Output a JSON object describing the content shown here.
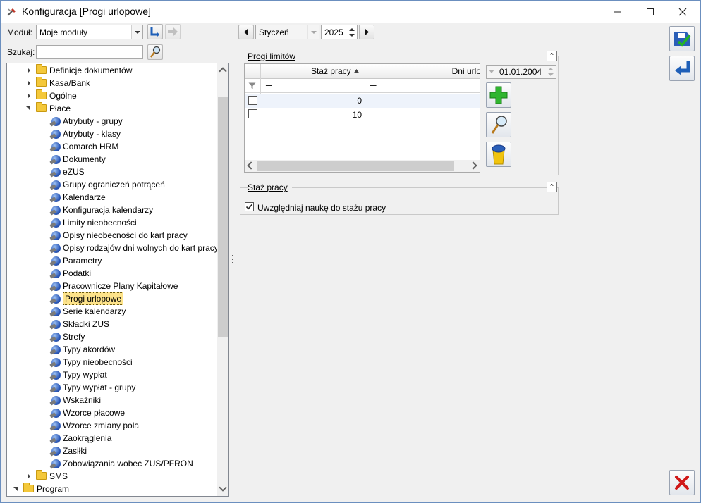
{
  "window": {
    "title": "Konfiguracja [Progi urlopowe]"
  },
  "toolbar": {
    "module_label": "Moduł:",
    "module_value": "Moje moduły",
    "search_label": "Szukaj:",
    "search_value": ""
  },
  "tree": {
    "top_items": [
      {
        "label": "Definicje dokumentów"
      },
      {
        "label": "Kasa/Bank"
      },
      {
        "label": "Ogólne"
      },
      {
        "label": "Płace"
      }
    ],
    "place_children": [
      {
        "label": "Atrybuty - grupy"
      },
      {
        "label": "Atrybuty - klasy"
      },
      {
        "label": "Comarch HRM"
      },
      {
        "label": "Dokumenty"
      },
      {
        "label": "eZUS"
      },
      {
        "label": "Grupy ograniczeń potrąceń"
      },
      {
        "label": "Kalendarze"
      },
      {
        "label": "Konfiguracja kalendarzy"
      },
      {
        "label": "Limity nieobecności"
      },
      {
        "label": "Opisy nieobecności do kart pracy"
      },
      {
        "label": "Opisy rodzajów dni wolnych do kart pracy"
      },
      {
        "label": "Parametry"
      },
      {
        "label": "Podatki"
      },
      {
        "label": "Pracownicze Plany Kapitałowe"
      },
      {
        "label": "Progi urlopowe"
      },
      {
        "label": "Serie kalendarzy"
      },
      {
        "label": "Składki ZUS"
      },
      {
        "label": "Strefy"
      },
      {
        "label": "Typy akordów"
      },
      {
        "label": "Typy nieobecności"
      },
      {
        "label": "Typy wypłat"
      },
      {
        "label": "Typy wypłat - grupy"
      },
      {
        "label": "Wskaźniki"
      },
      {
        "label": "Wzorce płacowe"
      },
      {
        "label": "Wzorce zmiany pola"
      },
      {
        "label": "Zaokrąglenia"
      },
      {
        "label": "Zasiłki"
      },
      {
        "label": "Zobowiązania wobec ZUS/PFRON"
      }
    ],
    "sms": "SMS",
    "program": "Program",
    "selected": "Progi urlopowe"
  },
  "period": {
    "month": "Styczeń",
    "year": "2025"
  },
  "progi": {
    "title": "Progi limitów",
    "col1": "Staż pracy",
    "col2": "Dni urlo",
    "filter_eq1": "═",
    "filter_eq2": "═",
    "rows": [
      {
        "staz": "0"
      },
      {
        "staz": "10"
      }
    ],
    "date": "01.01.2004"
  },
  "staz": {
    "title": "Staż pracy",
    "checkbox_label": "Uwzględniaj naukę do stażu pracy",
    "checked": true
  },
  "icons": {
    "collapse": "⌃"
  }
}
